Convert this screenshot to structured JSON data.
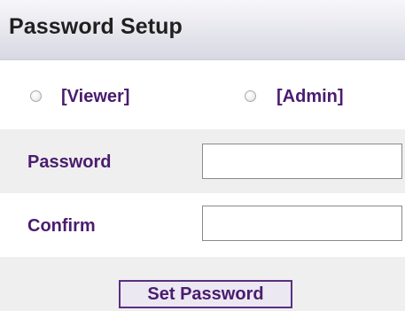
{
  "header": {
    "title": "Password Setup"
  },
  "roles": {
    "viewer_label": "[Viewer]",
    "admin_label": "[Admin]",
    "selected": null
  },
  "fields": {
    "password_label": "Password",
    "password_value": "",
    "confirm_label": "Confirm",
    "confirm_value": ""
  },
  "actions": {
    "set_password_label": "Set Password"
  },
  "colors": {
    "label_purple": "#4a1c6f",
    "button_border": "#5a2f82",
    "alt_row_bg": "#efefef"
  }
}
